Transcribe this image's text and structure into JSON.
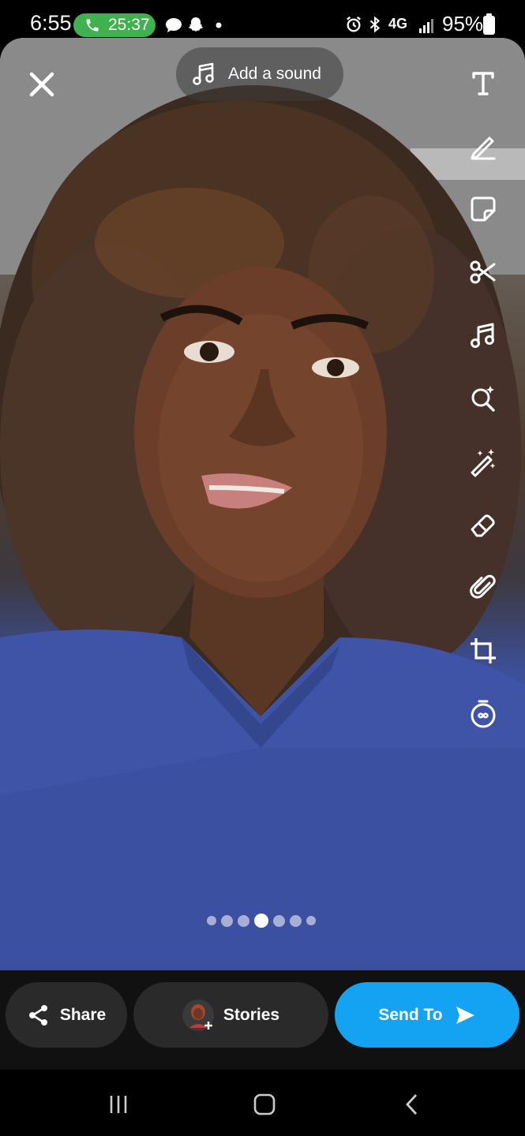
{
  "status_bar": {
    "time": "6:55",
    "call_timer": "25:37",
    "network": "4G",
    "battery": "95%"
  },
  "editor": {
    "add_sound_label": "Add a sound",
    "tools": [
      "text-icon",
      "pencil-icon",
      "sticker-icon",
      "scissors-icon",
      "music-icon",
      "search-sparkle-icon",
      "magic-wand-icon",
      "eraser-icon",
      "paperclip-icon",
      "crop-icon",
      "timer-icon"
    ],
    "page_dots": 7,
    "active_dot": 4
  },
  "actions": {
    "share_label": "Share",
    "stories_label": "Stories",
    "send_label": "Send To"
  },
  "colors": {
    "send_button": "#14a3f2",
    "call_pill": "#3fb14f",
    "dark_button": "#2a2a2a"
  }
}
